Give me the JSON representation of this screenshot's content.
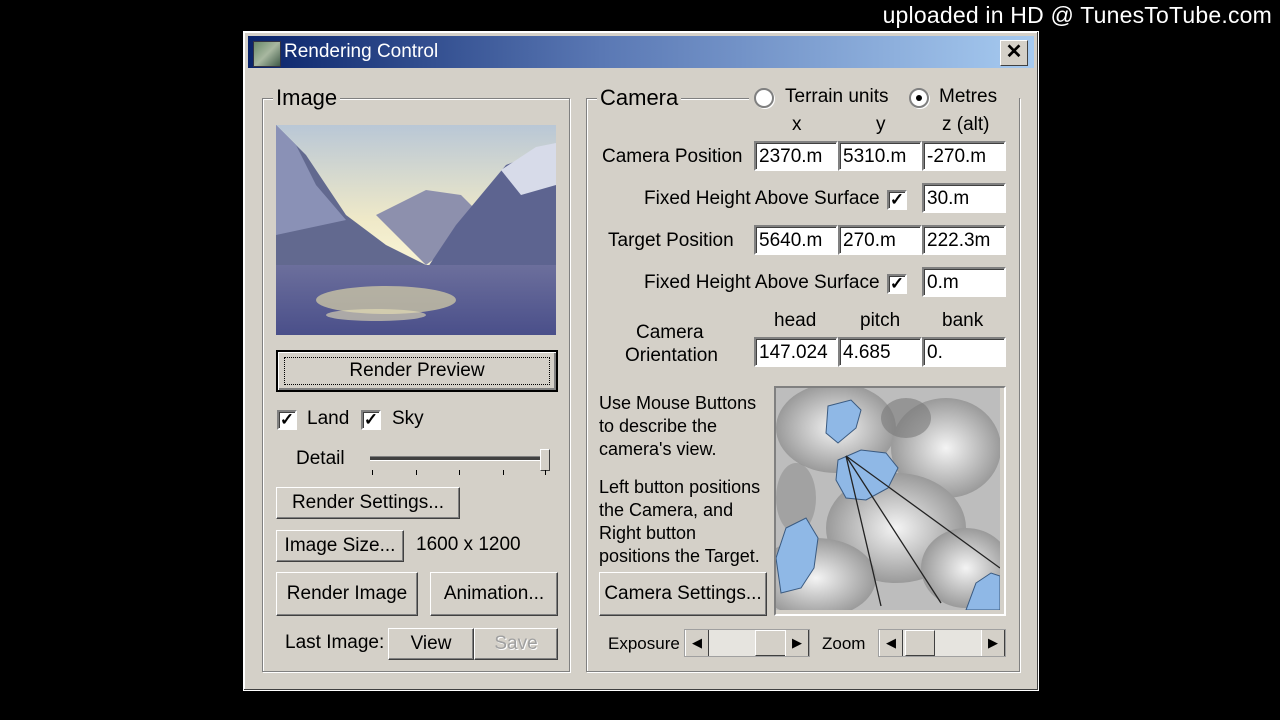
{
  "watermark": "uploaded in HD @ TunesToTube.com",
  "window": {
    "title": "Rendering Control",
    "close": "✕"
  },
  "image_group": {
    "legend": "Image",
    "render_preview_label": "Render Preview",
    "land_label": "Land",
    "land_checked": true,
    "sky_label": "Sky",
    "sky_checked": true,
    "detail_label": "Detail",
    "render_settings_label": "Render Settings...",
    "image_size_label": "Image Size...",
    "image_size_value": "1600 x 1200",
    "render_image_label": "Render Image",
    "animation_label": "Animation...",
    "last_image_label": "Last Image:",
    "view_label": "View",
    "save_label": "Save"
  },
  "camera_group": {
    "legend": "Camera",
    "terrain_units_label": "Terrain units",
    "terrain_units_selected": false,
    "metres_label": "Metres",
    "metres_selected": true,
    "col_x": "x",
    "col_y": "y",
    "col_z": "z (alt)",
    "camera_position_label": "Camera Position",
    "camera_x": "2370.m",
    "camera_y": "5310.m",
    "camera_z": "-270.m",
    "fixed_height_label": "Fixed Height Above Surface",
    "camera_fixed_checked": true,
    "camera_fixed_value": "30.m",
    "target_position_label": "Target Position",
    "target_x": "5640.m",
    "target_y": "270.m",
    "target_z": "222.3m",
    "target_fixed_checked": true,
    "target_fixed_value": "0.m",
    "orientation_label_1": "Camera",
    "orientation_label_2": "Orientation",
    "col_head": "head",
    "col_pitch": "pitch",
    "col_bank": "bank",
    "head_value": "147.024",
    "pitch_value": "4.685",
    "bank_value": "0.",
    "help_text_1a": "Use Mouse Buttons",
    "help_text_1b": "to describe the",
    "help_text_1c": "camera's view.",
    "help_text_2a": "Left button positions",
    "help_text_2b": "the Camera, and",
    "help_text_2c": "Right button",
    "help_text_2d": "positions the Target.",
    "camera_settings_label": "Camera Settings...",
    "exposure_label": "Exposure",
    "zoom_label": "Zoom"
  }
}
